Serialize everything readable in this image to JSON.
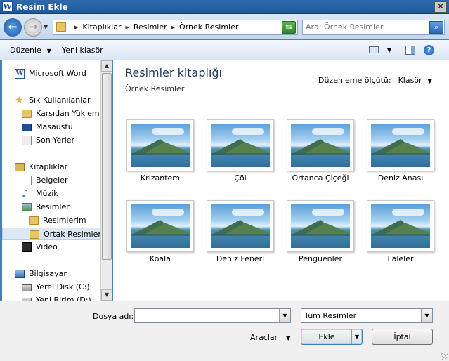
{
  "window": {
    "title": "Resim Ekle",
    "app_icon_letter": "W",
    "close_glyph": "✕"
  },
  "address": {
    "breadcrumbs": [
      "Kitaplıklar",
      "Resimler",
      "Örnek Resimler"
    ],
    "search_placeholder": "Ara: Örnek Resimler"
  },
  "toolbar": {
    "organize_label": "Düzenle",
    "new_folder_label": "Yeni klasör",
    "help_glyph": "?"
  },
  "sidebar": {
    "items": [
      {
        "label": "Microsoft Word",
        "icon": "word-icon",
        "indent": 0,
        "selected": false
      },
      {
        "label": "Sık Kullanılanlar",
        "icon": "star-icon",
        "indent": 0,
        "selected": false
      },
      {
        "label": "Karşıdan Yüklemeler",
        "icon": "folder-icon",
        "indent": 1,
        "selected": false
      },
      {
        "label": "Masaüstü",
        "icon": "desktop-icon",
        "indent": 1,
        "selected": false
      },
      {
        "label": "Son Yerler",
        "icon": "recent-icon",
        "indent": 1,
        "selected": false
      },
      {
        "label": "Kitaplıklar",
        "icon": "library-icon",
        "indent": 0,
        "selected": false
      },
      {
        "label": "Belgeler",
        "icon": "documents-icon",
        "indent": 1,
        "selected": false
      },
      {
        "label": "Müzik",
        "icon": "music-icon",
        "indent": 1,
        "selected": false
      },
      {
        "label": "Resimler",
        "icon": "pictures-icon",
        "indent": 1,
        "selected": false
      },
      {
        "label": "Resimlerim",
        "icon": "folder-icon",
        "indent": 2,
        "selected": false
      },
      {
        "label": "Ortak Resimler",
        "icon": "folder-icon",
        "indent": 2,
        "selected": true
      },
      {
        "label": "Video",
        "icon": "video-icon",
        "indent": 1,
        "selected": false
      },
      {
        "label": "Bilgisayar",
        "icon": "computer-icon",
        "indent": 0,
        "selected": false
      },
      {
        "label": "Yerel Disk (C:)",
        "icon": "disk-icon",
        "indent": 1,
        "selected": false
      },
      {
        "label": "Yeni Birim (D:)",
        "icon": "disk-icon",
        "indent": 1,
        "selected": false
      }
    ]
  },
  "main": {
    "library_title": "Resimler kitaplığı",
    "library_subtitle": "Örnek Resimler",
    "arrange_label": "Düzenleme ölçütü:",
    "arrange_value": "Klasör",
    "thumbnails": [
      "Krizantem",
      "Çöl",
      "Ortanca Çiçeği",
      "Deniz Anası",
      "Koala",
      "Deniz Feneri",
      "Penguenler",
      "Laleler"
    ]
  },
  "bottom": {
    "filename_label": "Dosya adı:",
    "filename_value": "",
    "filetype_value": "Tüm Resimler",
    "tools_label": "Araçlar",
    "insert_label": "Ekle",
    "cancel_label": "İptal"
  },
  "colors": {
    "titlebar": "#2e6aad",
    "selection": "#dde8f5",
    "library_title": "#1e395b"
  }
}
